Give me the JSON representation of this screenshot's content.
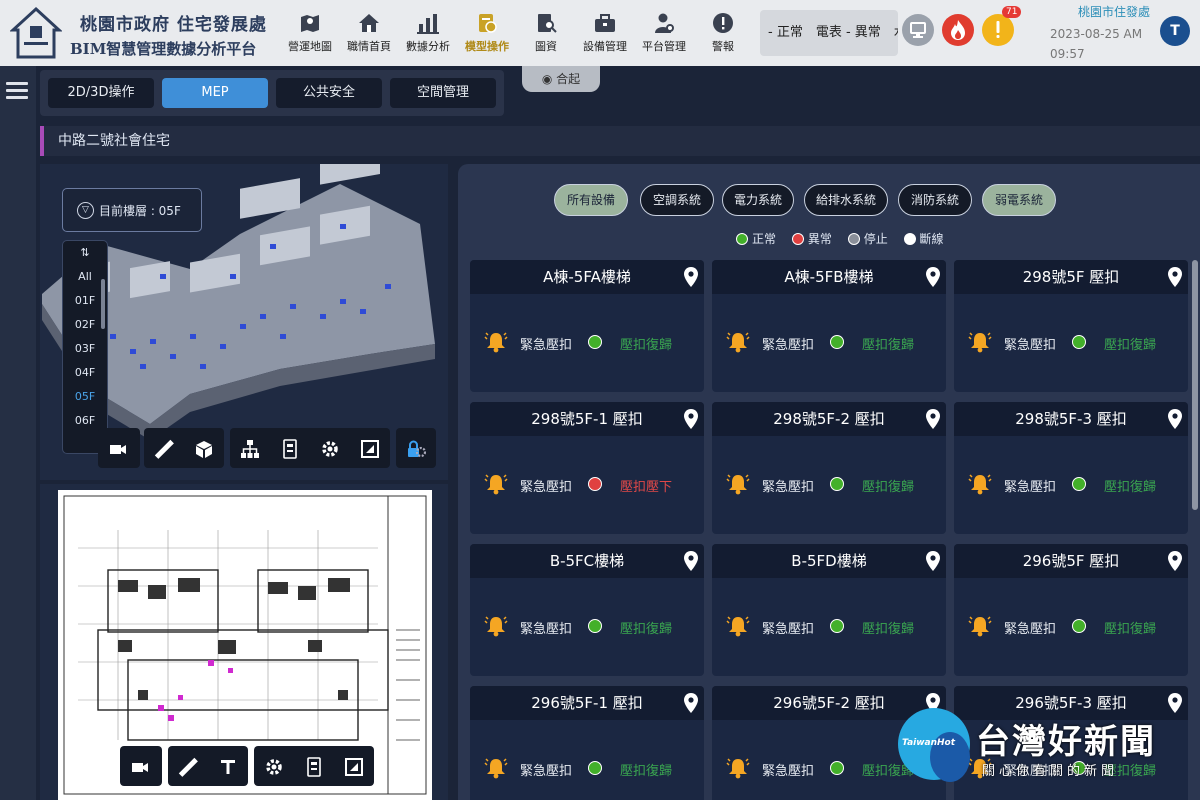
{
  "header": {
    "logo_title": "桃園市政府 住宅發展處",
    "logo_subtitle": "BIM智慧管理數據分析平台",
    "nav": [
      {
        "label": "營運地圖",
        "icon": "map-icon"
      },
      {
        "label": "職情首頁",
        "icon": "home-icon"
      },
      {
        "label": "數據分析",
        "icon": "bar-chart-icon"
      },
      {
        "label": "模型操作",
        "icon": "model-icon",
        "active": true
      },
      {
        "label": "圖資",
        "icon": "document-search-icon"
      },
      {
        "label": "設備管理",
        "icon": "toolbox-icon"
      },
      {
        "label": "平台管理",
        "icon": "user-settings-icon"
      },
      {
        "label": "警報",
        "icon": "alert-icon"
      }
    ],
    "ticker": "- 正常　電表 - 異常　水",
    "alert_count": "71",
    "org": "桃園市住發處",
    "date": "2023-08-25 AM",
    "time": "09:57",
    "avatar": "T"
  },
  "tabs": [
    {
      "label": "2D/3D操作"
    },
    {
      "label": "MEP",
      "active": true
    },
    {
      "label": "公共安全"
    },
    {
      "label": "空間管理"
    }
  ],
  "collapse_label": "合起",
  "page_title": "中路二號社會住宅",
  "floor": {
    "current_label": "目前樓層 : 05F",
    "options": [
      "All",
      "01F",
      "02F",
      "03F",
      "04F",
      "05F",
      "06F"
    ],
    "selected": "05F"
  },
  "filters": [
    {
      "label": "所有設備",
      "active": true
    },
    {
      "label": "空調系統"
    },
    {
      "label": "電力系統"
    },
    {
      "label": "給排水系統"
    },
    {
      "label": "消防系統"
    },
    {
      "label": "弱電系統",
      "active": true
    }
  ],
  "legend": [
    {
      "label": "正常",
      "color": "#43b02a"
    },
    {
      "label": "異常",
      "color": "#e04040"
    },
    {
      "label": "停止",
      "color": "#8a8f99"
    },
    {
      "label": "斷線",
      "color": "#ffffff"
    }
  ],
  "devices": [
    {
      "title": "A棟-5FA樓梯",
      "label": "緊急壓扣",
      "status": "壓扣復歸",
      "state": "normal"
    },
    {
      "title": "A棟-5FB樓梯",
      "label": "緊急壓扣",
      "status": "壓扣復歸",
      "state": "normal"
    },
    {
      "title": "298號5F 壓扣",
      "label": "緊急壓扣",
      "status": "壓扣復歸",
      "state": "normal"
    },
    {
      "title": "298號5F-1 壓扣",
      "label": "緊急壓扣",
      "status": "壓扣壓下",
      "state": "abnormal"
    },
    {
      "title": "298號5F-2 壓扣",
      "label": "緊急壓扣",
      "status": "壓扣復歸",
      "state": "normal"
    },
    {
      "title": "298號5F-3 壓扣",
      "label": "緊急壓扣",
      "status": "壓扣復歸",
      "state": "normal"
    },
    {
      "title": "B-5FC樓梯",
      "label": "緊急壓扣",
      "status": "壓扣復歸",
      "state": "normal"
    },
    {
      "title": "B-5FD樓梯",
      "label": "緊急壓扣",
      "status": "壓扣復歸",
      "state": "normal"
    },
    {
      "title": "296號5F 壓扣",
      "label": "緊急壓扣",
      "status": "壓扣復歸",
      "state": "normal"
    },
    {
      "title": "296號5F-1 壓扣",
      "label": "緊急壓扣",
      "status": "壓扣復歸",
      "state": "normal"
    },
    {
      "title": "296號5F-2 壓扣",
      "label": "緊急壓扣",
      "status": "壓扣復歸",
      "state": "normal"
    },
    {
      "title": "296號5F-3 壓扣",
      "label": "緊急壓扣",
      "status": "壓扣復歸",
      "state": "normal"
    }
  ],
  "colors": {
    "normal": "#43b02a",
    "abnormal": "#e04040",
    "normal_text": "#3aa650",
    "abnormal_text": "#e04848",
    "bell": "#f5a623"
  },
  "watermark": {
    "name": "台灣好新聞",
    "slogan": "關心你有關的新聞",
    "brand": "TaiwanHot"
  }
}
